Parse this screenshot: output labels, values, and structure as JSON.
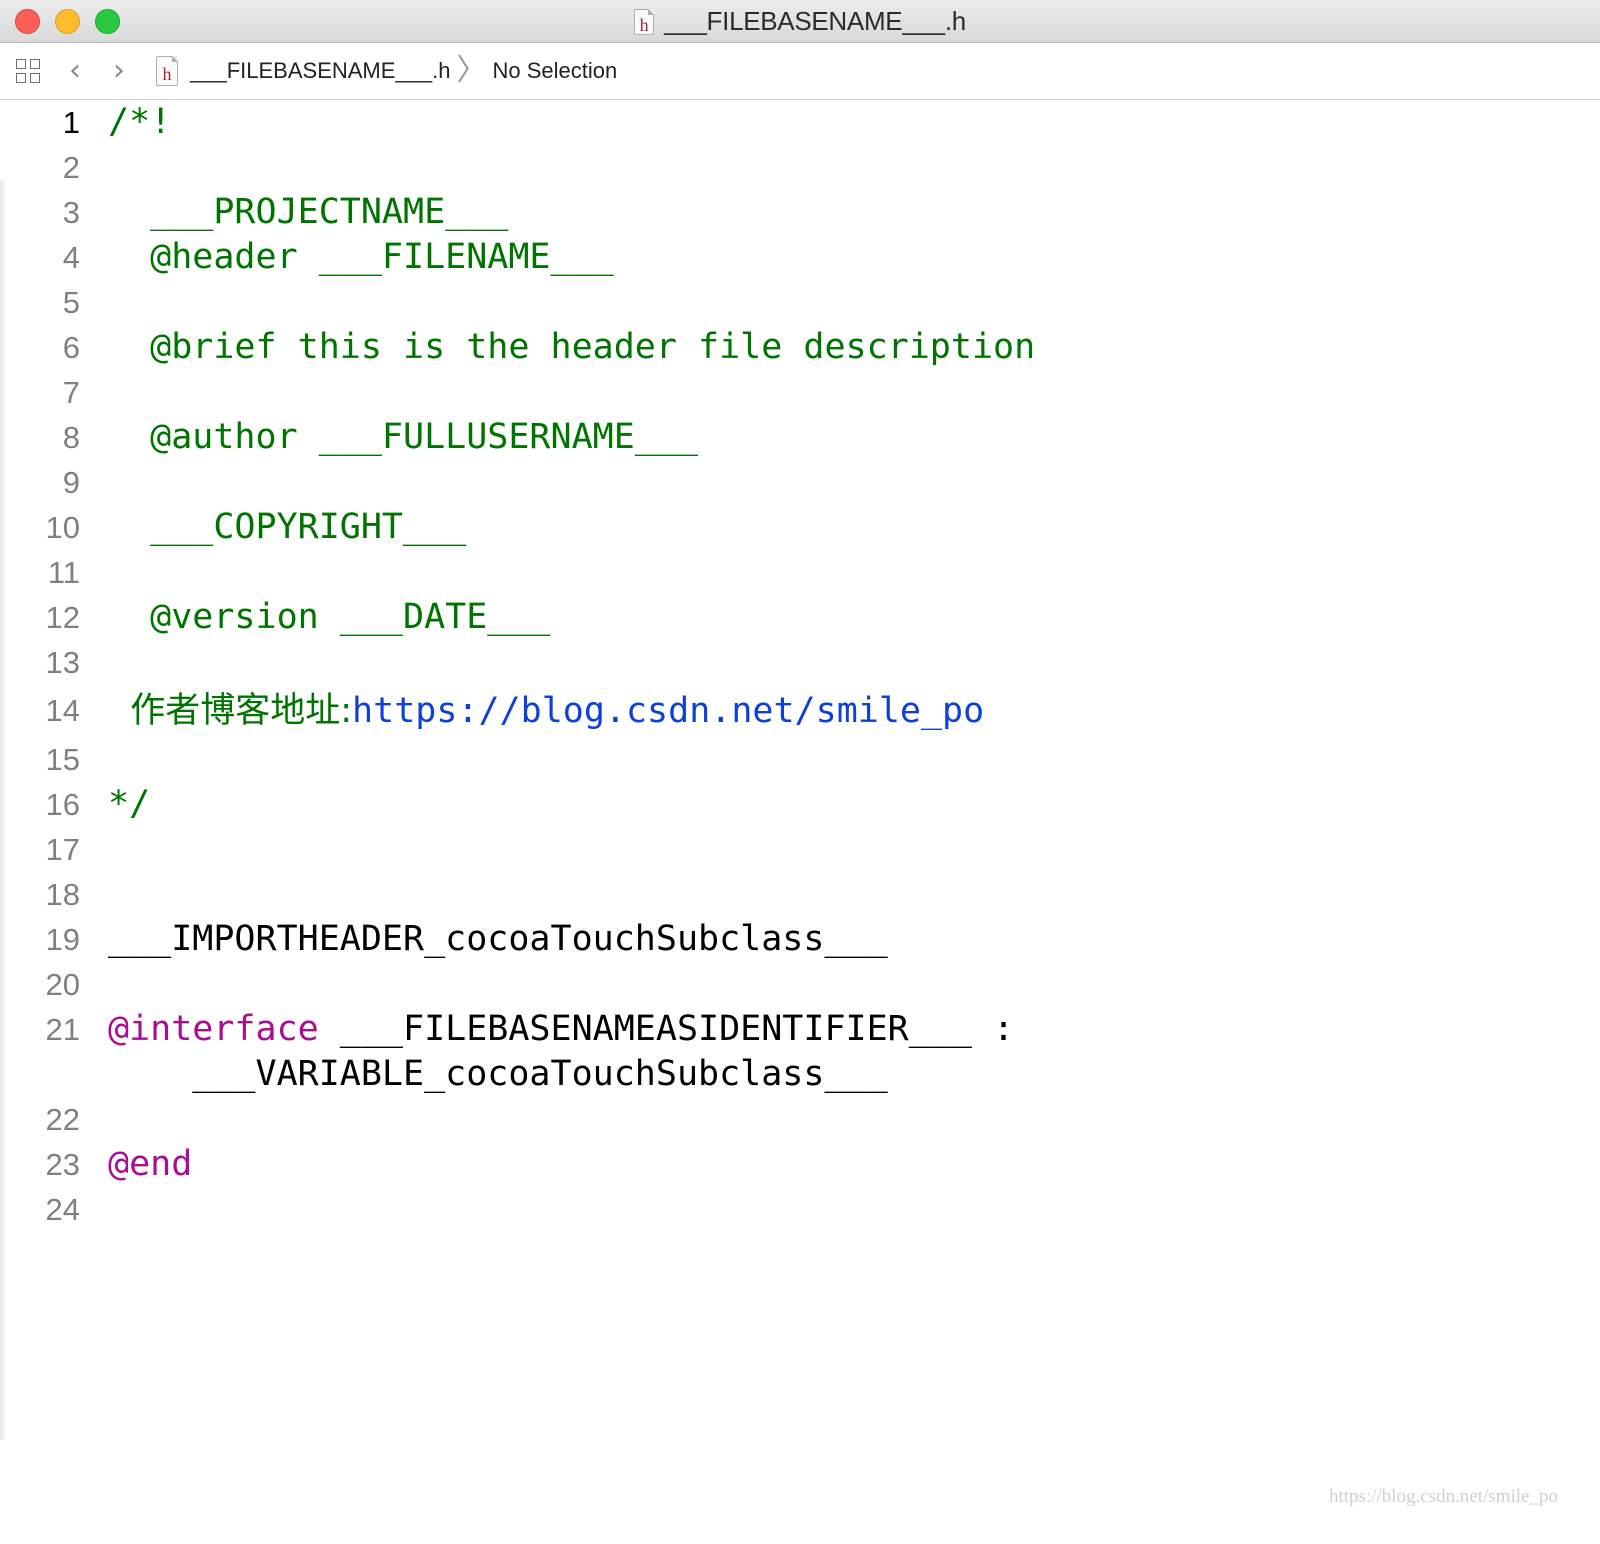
{
  "window": {
    "title": "___FILEBASENAME___.h",
    "file_icon_letter": "h"
  },
  "jumpbar": {
    "file_name": "___FILEBASENAME___.h",
    "separator": "〉",
    "selection": "No Selection",
    "back_glyph": "‹",
    "forward_glyph": "›"
  },
  "editor": {
    "current_line": 1,
    "lines": [
      {
        "num": "1",
        "text": "/*!"
      },
      {
        "num": "2",
        "text": ""
      },
      {
        "num": "3",
        "text": "  ___PROJECTNAME___"
      },
      {
        "num": "4",
        "text": "  @header ___FILENAME___"
      },
      {
        "num": "5",
        "text": ""
      },
      {
        "num": "6",
        "text": "  @brief this is the header file description"
      },
      {
        "num": "7",
        "text": ""
      },
      {
        "num": "8",
        "text": "  @author ___FULLUSERNAME___"
      },
      {
        "num": "9",
        "text": ""
      },
      {
        "num": "10",
        "text": "  ___COPYRIGHT___"
      },
      {
        "num": "11",
        "text": ""
      },
      {
        "num": "12",
        "text": "  @version ___DATE___"
      },
      {
        "num": "13",
        "text": ""
      },
      {
        "num": "14",
        "text_prefix": "  作者博客地址:",
        "url": "https://blog.csdn.net/smile_po"
      },
      {
        "num": "15",
        "text": ""
      },
      {
        "num": "16",
        "text": "*/"
      },
      {
        "num": "17",
        "text": ""
      },
      {
        "num": "18",
        "text": ""
      },
      {
        "num": "19",
        "text": "___IMPORTHEADER_cocoaTouchSubclass___"
      },
      {
        "num": "20",
        "text": ""
      },
      {
        "num": "21",
        "keyword": "@interface",
        "text": " ___FILEBASENAMEASIDENTIFIER___ :",
        "continuation": "    ___VARIABLE_cocoaTouchSubclass___"
      },
      {
        "num": "22",
        "text": ""
      },
      {
        "num": "23",
        "keyword": "@end"
      },
      {
        "num": "24",
        "text": ""
      }
    ]
  },
  "watermark": "https://blog.csdn.net/smile_po",
  "colors": {
    "comment": "#007400",
    "url": "#0e3fd8",
    "keyword": "#aa0d91",
    "line_number": "#808080"
  }
}
